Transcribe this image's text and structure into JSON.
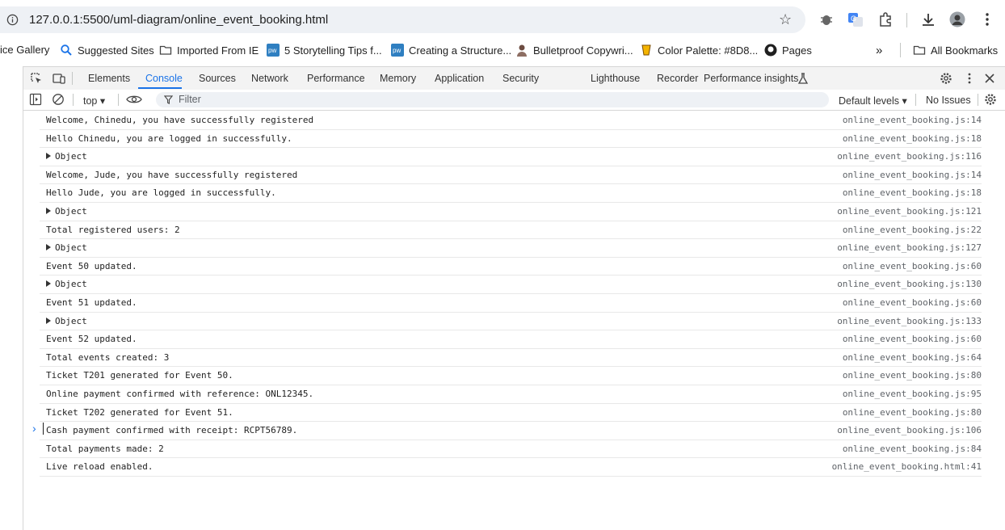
{
  "address_bar": {
    "url": "127.0.0.1:5500/uml-diagram/online_event_booking.html"
  },
  "bookmarks": {
    "items": [
      {
        "label": "ice Gallery",
        "icon": ""
      },
      {
        "label": "Suggested Sites",
        "icon": "search-icon"
      },
      {
        "label": "Imported From IE",
        "icon": "folder-icon"
      },
      {
        "label": "5 Storytelling Tips f...",
        "icon": "pw-icon"
      },
      {
        "label": "Creating a Structure...",
        "icon": "pw-icon"
      },
      {
        "label": "Bulletproof Copywri...",
        "icon": "person-icon"
      },
      {
        "label": "Color Palette: #8D8...",
        "icon": "cup-icon"
      },
      {
        "label": "Pages",
        "icon": "github-icon"
      }
    ],
    "overflow": "»",
    "all_bookmarks": "All Bookmarks"
  },
  "devtools": {
    "tabs": [
      "Elements",
      "Console",
      "Sources",
      "Network",
      "Performance",
      "Memory",
      "Application",
      "Security",
      "Lighthouse",
      "Recorder",
      "Performance insights"
    ],
    "active_tab": "Console",
    "toolbar": {
      "context": "top",
      "filter_placeholder": "Filter",
      "levels": "Default levels",
      "issues": "No Issues"
    }
  },
  "console": {
    "rows": [
      {
        "msg": "Welcome, Chinedu, you have successfully registered",
        "src": "online_event_booking.js:14",
        "object": false
      },
      {
        "msg": "Hello Chinedu, you are logged in successfully.",
        "src": "online_event_booking.js:18",
        "object": false
      },
      {
        "msg": "Object",
        "src": "online_event_booking.js:116",
        "object": true
      },
      {
        "msg": "Welcome, Jude, you have successfully registered",
        "src": "online_event_booking.js:14",
        "object": false
      },
      {
        "msg": "Hello Jude, you are logged in successfully.",
        "src": "online_event_booking.js:18",
        "object": false
      },
      {
        "msg": "Object",
        "src": "online_event_booking.js:121",
        "object": true
      },
      {
        "msg": "Total registered users: 2",
        "src": "online_event_booking.js:22",
        "object": false
      },
      {
        "msg": "Object",
        "src": "online_event_booking.js:127",
        "object": true
      },
      {
        "msg": "Event 50 updated.",
        "src": "online_event_booking.js:60",
        "object": false
      },
      {
        "msg": "Object",
        "src": "online_event_booking.js:130",
        "object": true
      },
      {
        "msg": "Event 51 updated.",
        "src": "online_event_booking.js:60",
        "object": false
      },
      {
        "msg": "Object",
        "src": "online_event_booking.js:133",
        "object": true
      },
      {
        "msg": "Event 52 updated.",
        "src": "online_event_booking.js:60",
        "object": false
      },
      {
        "msg": "Total events created: 3",
        "src": "online_event_booking.js:64",
        "object": false
      },
      {
        "msg": "Ticket T201 generated for Event 50.",
        "src": "online_event_booking.js:80",
        "object": false
      },
      {
        "msg": "Online payment confirmed with reference: ONL12345.",
        "src": "online_event_booking.js:95",
        "object": false
      },
      {
        "msg": "Ticket T202 generated for Event 51.",
        "src": "online_event_booking.js:80",
        "object": false
      },
      {
        "msg": "Cash payment confirmed with receipt: RCPT56789.",
        "src": "online_event_booking.js:106",
        "object": false
      },
      {
        "msg": "Total payments made: 2",
        "src": "online_event_booking.js:84",
        "object": false
      },
      {
        "msg": "Live reload enabled.",
        "src": "online_event_booking.html:41",
        "object": false
      }
    ],
    "prompt": "›"
  }
}
